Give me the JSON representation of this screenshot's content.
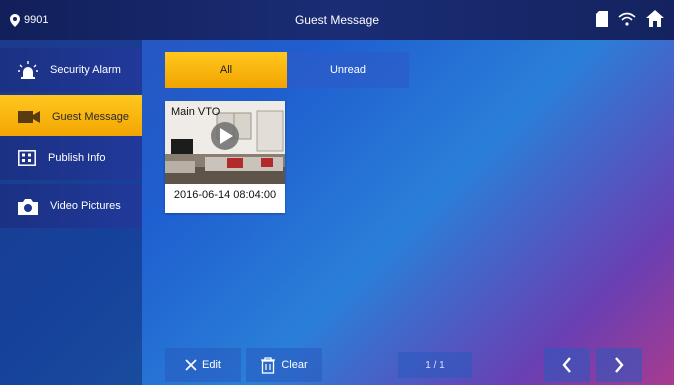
{
  "topbar": {
    "room_number": "9901",
    "title": "Guest Message",
    "icons": [
      "location-pin-icon",
      "sd-card-icon",
      "wifi-icon",
      "home-icon"
    ]
  },
  "sidebar": {
    "items": [
      {
        "label": "Security Alarm",
        "icon": "alarm-icon",
        "active": false
      },
      {
        "label": "Guest Message",
        "icon": "video-camera-icon",
        "active": true
      },
      {
        "label": "Publish Info",
        "icon": "building-icon",
        "active": false
      },
      {
        "label": "Video Pictures",
        "icon": "camera-icon",
        "active": false
      }
    ]
  },
  "tabs": {
    "all": "All",
    "unread": "Unread",
    "selected": "All"
  },
  "messages": [
    {
      "source": "Main VTO",
      "timestamp": "2016-06-14 08:04:00"
    }
  ],
  "toolbar": {
    "edit_label": "Edit",
    "clear_label": "Clear",
    "page_indicator": "1 / 1"
  },
  "colors": {
    "accent": "#f5b400",
    "topbar": "#14235f"
  }
}
